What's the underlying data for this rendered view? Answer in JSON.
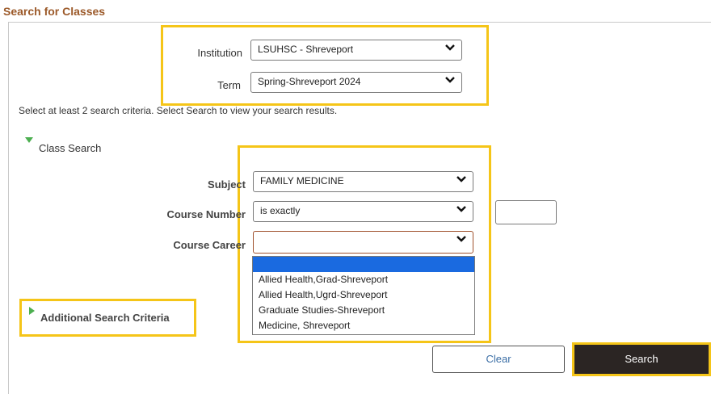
{
  "page_title": "Search for Classes",
  "institution": {
    "label": "Institution",
    "value": "LSUHSC - Shreveport"
  },
  "term": {
    "label": "Term",
    "value": "Spring-Shreveport 2024"
  },
  "info_text": "Select at least 2 search criteria. Select Search to view your search results.",
  "class_search": {
    "section_title": "Class Search",
    "subject": {
      "label": "Subject",
      "value": "FAMILY MEDICINE"
    },
    "course_number": {
      "label": "Course Number",
      "operator": "is exactly",
      "value": ""
    },
    "course_career": {
      "label": "Course Career",
      "value": "",
      "options": [
        "",
        "Allied Health,Grad-Shreveport",
        "Allied Health,Ugrd-Shreveport",
        "Graduate Studies-Shreveport",
        "Medicine, Shreveport"
      ]
    }
  },
  "additional_criteria": {
    "label": "Additional Search Criteria"
  },
  "buttons": {
    "clear": "Clear",
    "search": "Search"
  },
  "colors": {
    "title": "#9c5a2a",
    "highlight": "#f5c518",
    "selected_option": "#1a6ae0",
    "search_button": "#2b2523",
    "clear_text": "#3b6ea5",
    "expand_icon": "#4caf50"
  }
}
